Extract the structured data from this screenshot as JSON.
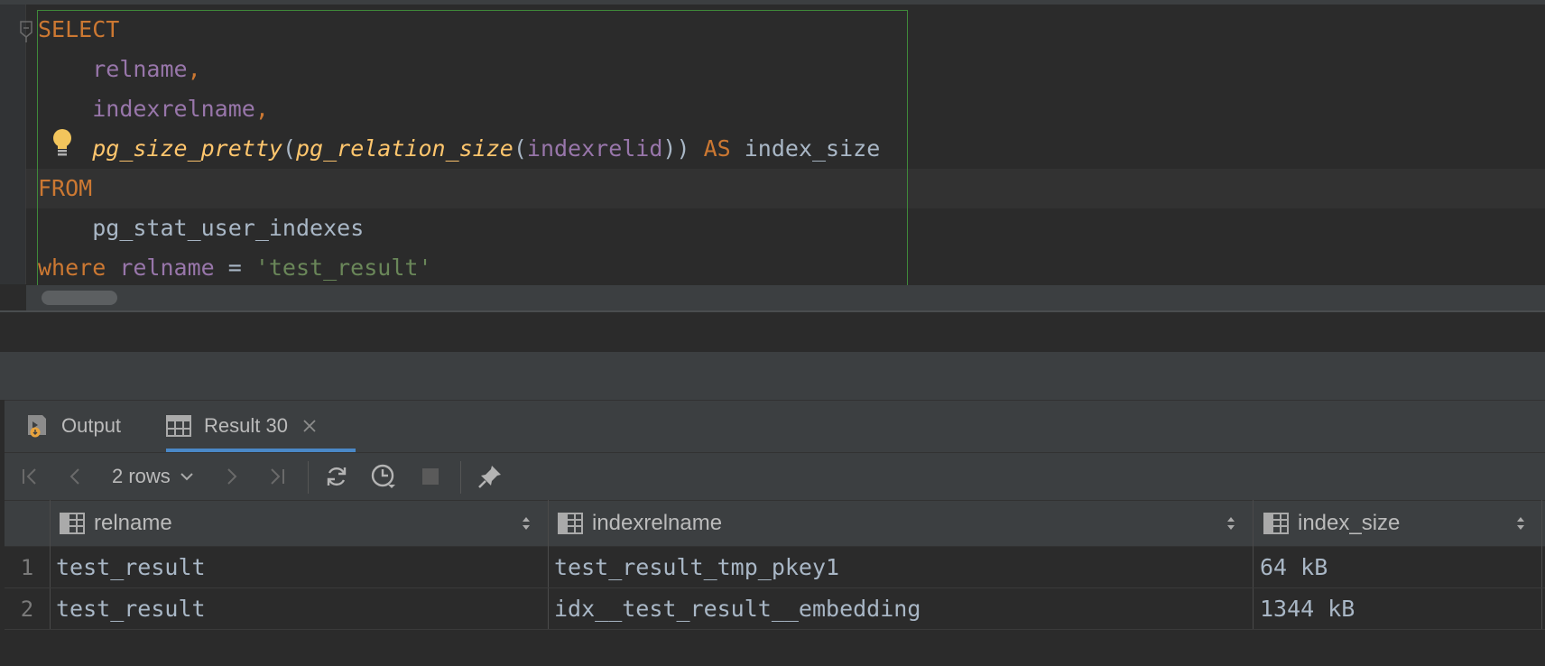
{
  "editor": {
    "lines": [
      {
        "parts": [
          {
            "t": "SELECT",
            "c": "kw"
          }
        ]
      },
      {
        "parts": [
          {
            "t": "    "
          },
          {
            "t": "relname",
            "c": "col"
          },
          {
            "t": ",",
            "c": "kw"
          }
        ]
      },
      {
        "parts": [
          {
            "t": "    "
          },
          {
            "t": "indexrelname",
            "c": "col"
          },
          {
            "t": ",",
            "c": "kw"
          }
        ]
      },
      {
        "parts": [
          {
            "t": "    "
          },
          {
            "t": "pg_size_pretty",
            "c": "fn"
          },
          {
            "t": "(",
            "c": "punc"
          },
          {
            "t": "pg_relation_size",
            "c": "fn"
          },
          {
            "t": "(",
            "c": "punc"
          },
          {
            "t": "indexrelid",
            "c": "col"
          },
          {
            "t": "))",
            "c": "punc"
          },
          {
            "t": " AS ",
            "c": "kw"
          },
          {
            "t": "index_size",
            "c": "punc"
          }
        ]
      },
      {
        "parts": [
          {
            "t": "FROM",
            "c": "kw"
          }
        ]
      },
      {
        "parts": [
          {
            "t": "    "
          },
          {
            "t": "pg_stat_user_indexes",
            "c": "punc"
          }
        ]
      },
      {
        "parts": [
          {
            "t": "where ",
            "c": "kw"
          },
          {
            "t": "relname",
            "c": "col"
          },
          {
            "t": " = ",
            "c": "punc"
          },
          {
            "t": "'test_result'",
            "c": "str"
          }
        ]
      }
    ]
  },
  "tabs": {
    "output_label": "Output",
    "result_label": "Result 30"
  },
  "toolbar": {
    "rows_label": "2 rows"
  },
  "grid": {
    "columns": [
      "relname",
      "indexrelname",
      "index_size"
    ],
    "rows": [
      {
        "num": "1",
        "relname": "test_result",
        "indexrelname": "test_result_tmp_pkey1",
        "index_size": "64 kB"
      },
      {
        "num": "2",
        "relname": "test_result",
        "indexrelname": "idx__test_result__embedding",
        "index_size": "1344 kB"
      }
    ]
  },
  "colors": {
    "keyword": "#cc7832",
    "column": "#9876aa",
    "function": "#ffc66d",
    "string": "#6a8759",
    "accent": "#4a88c7"
  },
  "icons": {
    "fold": "fold-icon",
    "bulb": "bulb-icon",
    "output": "output-icon",
    "table": "table-icon",
    "close": "close-icon",
    "first": "first-page-icon",
    "prev": "prev-page-icon",
    "next": "next-page-icon",
    "last": "last-page-icon",
    "refresh": "refresh-icon",
    "history": "history-icon",
    "stop": "stop-icon",
    "pin": "pin-icon",
    "sort": "sort-icon",
    "chevron": "chevron-down-icon"
  }
}
